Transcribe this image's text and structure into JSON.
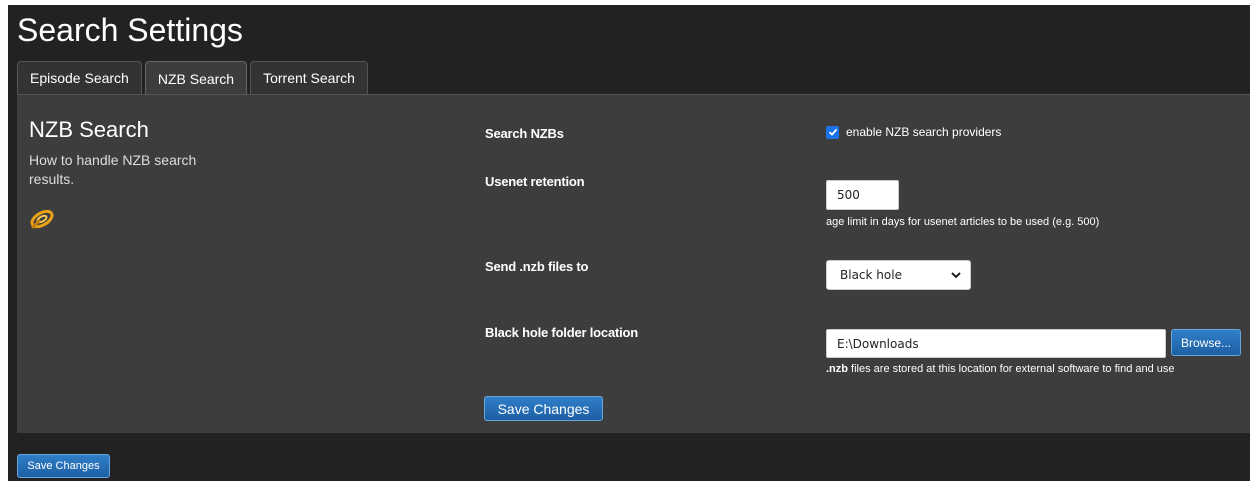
{
  "page": {
    "title": "Search Settings"
  },
  "tabs": [
    {
      "label": "Episode Search"
    },
    {
      "label": "NZB Search"
    },
    {
      "label": "Torrent Search"
    }
  ],
  "active_tab": "NZB Search",
  "section": {
    "title": "NZB Search",
    "description": "How to handle NZB search results.",
    "icon": "nzb-provider-icon"
  },
  "fields": {
    "search_nzbs": {
      "label": "Search NZBs",
      "checkbox_label": "enable NZB search providers",
      "checked": true
    },
    "usenet_retention": {
      "label": "Usenet retention",
      "value": "500",
      "help": "age limit in days for usenet articles to be used (e.g. 500)"
    },
    "send_nzb_to": {
      "label": "Send .nzb files to",
      "selected": "Black hole"
    },
    "black_hole": {
      "label": "Black hole folder location",
      "value": "E:\\Downloads",
      "browse_label": "Browse...",
      "help_bold": ".nzb",
      "help_rest": " files are stored at this location for external software to find and use"
    }
  },
  "buttons": {
    "save_panel": "Save Changes",
    "save_page": "Save Changes"
  },
  "colors": {
    "background": "#222222",
    "panel": "#3d3d3d",
    "accent": "#1e5fa3",
    "checkbox": "#1a73e8"
  }
}
